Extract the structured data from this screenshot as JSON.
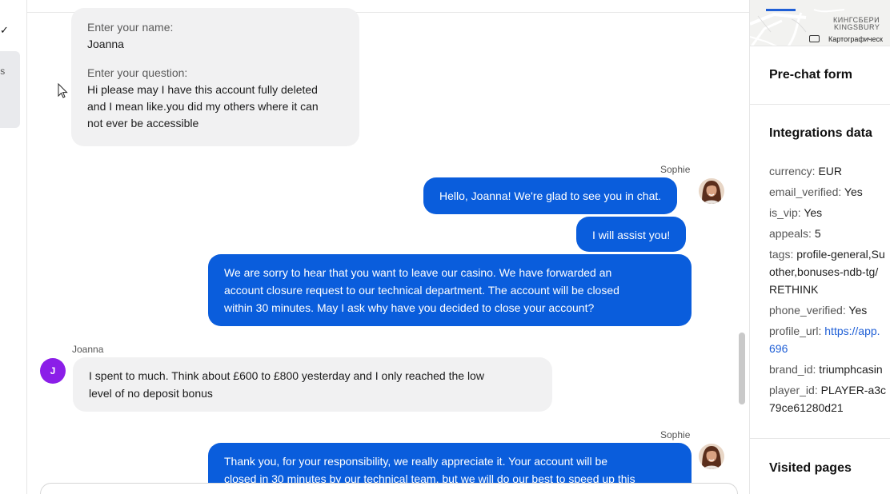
{
  "left_strip": {
    "partial_text": "'s"
  },
  "prechat": {
    "name_label": "Enter your name:",
    "name_value": "Joanna",
    "question_label": "Enter your question:",
    "question_lines": [
      "Hi please may I have this account fully deleted",
      "and I mean like.you did my others where it can",
      "not ever be accessible"
    ]
  },
  "messages": {
    "agent_name": "Sophie",
    "visitor_name": "Joanna",
    "visitor_initial": "J",
    "m1": "Hello, Joanna! We're glad to see you in chat.",
    "m2": "I will assist you!",
    "m3_lines": [
      "We are sorry to hear that you want to leave our casino. We have forwarded an",
      "account closure request to our technical department. The account will be closed",
      "within 30 minutes. May I ask why have you decided to close your account?"
    ],
    "m4_lines": [
      "I spent to much. Think about £600 to £800 yesterday and I only reached the low",
      "level of no deposit bonus"
    ],
    "m5_lines": [
      "Thank you, for your responsibility, we really appreciate it. Your account will be",
      "closed in 30 minutes by our technical team, but we will do our best to speed up this"
    ]
  },
  "map": {
    "city_ru": "КИНГСБЕРИ",
    "city_en": "KINGSBURY",
    "credit": "Картографическ"
  },
  "panel": {
    "prechat_title": "Pre-chat form",
    "integrations_title": "Integrations data",
    "visited_title": "Visited pages",
    "rows": {
      "currency": {
        "key": "currency:",
        "value": " EUR"
      },
      "email_verified": {
        "key": "email_verified:",
        "value": " Yes"
      },
      "is_vip": {
        "key": "is_vip:",
        "value": " Yes"
      },
      "appeals": {
        "key": "appeals:",
        "value": " 5"
      },
      "tags": {
        "key": "tags:",
        "value_lines": [
          " profile-general,Su",
          "other,bonuses-ndb-tg/",
          "RETHINK"
        ]
      },
      "phone_verified": {
        "key": "phone_verified:",
        "value": " Yes"
      },
      "profile_url": {
        "key": "profile_url:",
        "value_lines": [
          " https://app.",
          "696"
        ]
      },
      "brand_id": {
        "key": "brand_id:",
        "value": " triumphcasin"
      },
      "player_id": {
        "key": "player_id:",
        "value_lines": [
          " PLAYER-a3c",
          "79ce61280d21"
        ]
      }
    }
  },
  "colors": {
    "agent_bubble": "#0a5ddc",
    "visitor_bubble": "#f1f1f2",
    "visitor_avatar": "#8b1ee8",
    "link": "#1f5fd6"
  }
}
